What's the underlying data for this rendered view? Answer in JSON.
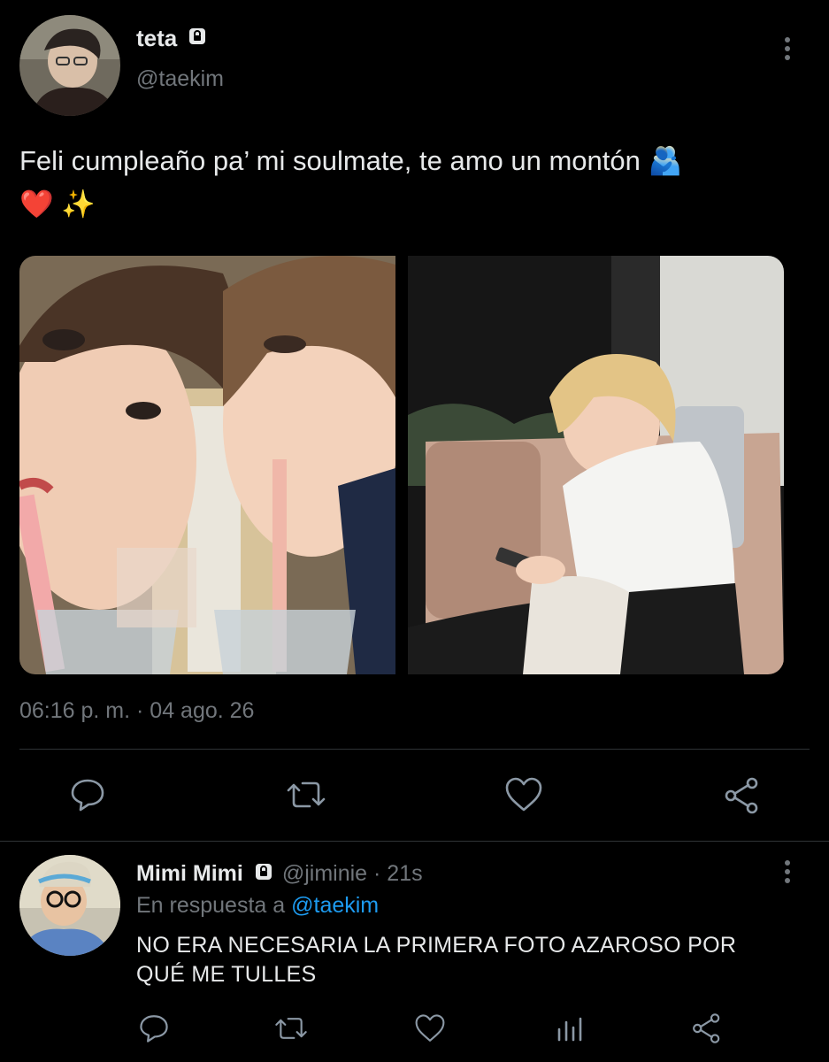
{
  "tweet": {
    "display_name": "teta",
    "handle": "@taekim",
    "text_line1": "Feli cumpleaño pa’ mi soulmate, te amo un montón 🫂",
    "text_line2": "❤️ ✨",
    "timestamp": "06:16 p. m. · 04 ago. 26",
    "actions": [
      "reply-icon",
      "retweet-icon",
      "like-icon",
      "share-icon"
    ]
  },
  "reply": {
    "display_name": "Mimi Mimi",
    "handle_time": "@jiminie · 21s",
    "replying_prefix": "En respuesta a",
    "replying_to": "@taekim",
    "text_line1": "NO ERA NECESARIA LA PRIMERA FOTO AZAROSO POR",
    "text_line2": "QUÉ ME TULLES",
    "actions": [
      "reply-icon",
      "retweet-icon",
      "like-icon",
      "analytics-icon",
      "share-icon"
    ]
  },
  "colors": {
    "background": "#000000",
    "text": "#e7e9ea",
    "secondary": "#71767b",
    "link": "#1d9bf0",
    "divider": "#2f3336"
  }
}
